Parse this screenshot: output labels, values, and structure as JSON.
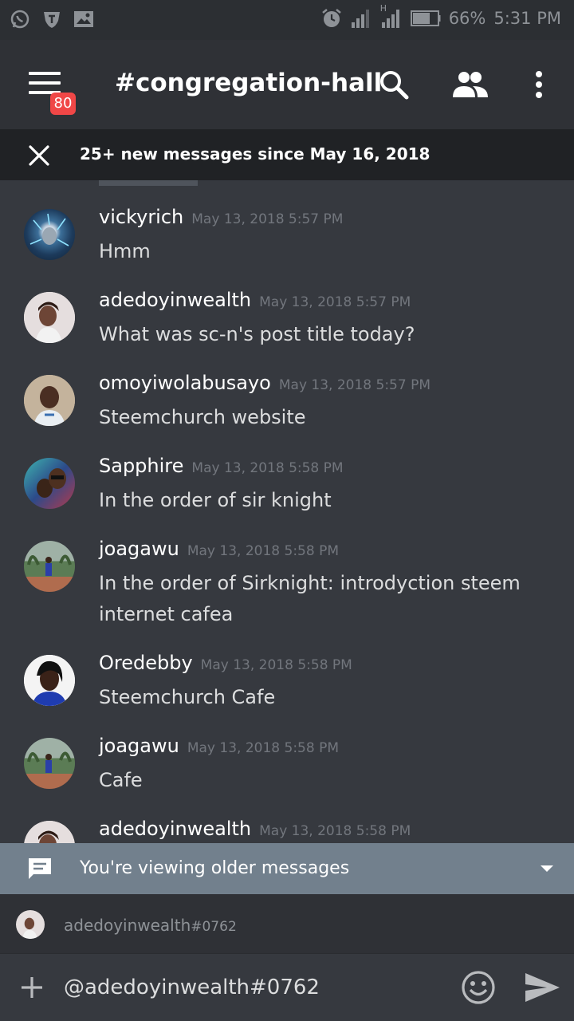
{
  "status_bar": {
    "battery": "66%",
    "time": "5:31 PM",
    "network": "H",
    "icons": [
      "whatsapp-icon",
      "shield-icon",
      "image-icon",
      "alarm-icon",
      "signal-icon",
      "battery-icon"
    ]
  },
  "header": {
    "channel": "#congregation-hall",
    "badge_count": "80",
    "icons": [
      "menu-icon",
      "search-icon",
      "members-icon",
      "more-icon"
    ]
  },
  "new_messages_bar": {
    "text": "25+ new messages since May 16, 2018"
  },
  "messages": [
    {
      "author": "vickyrich",
      "time": "May 13, 2018 5:57 PM",
      "text": "Hmm"
    },
    {
      "author": "adedoyinwealth",
      "time": "May 13, 2018 5:57 PM",
      "text": "What was sc-n's post title today?"
    },
    {
      "author": "omoyiwolabusayo",
      "time": "May 13, 2018 5:57 PM",
      "text": "Steemchurch website"
    },
    {
      "author": "Sapphire",
      "time": "May 13, 2018 5:58 PM",
      "text": "In the order of sir knight"
    },
    {
      "author": "joagawu",
      "time": "May 13, 2018 5:58 PM",
      "text": "In the order of Sirknight: introdyction steem internet cafea"
    },
    {
      "author": "Oredebby",
      "time": "May 13, 2018 5:58 PM",
      "text": "Steemchurch Cafe"
    },
    {
      "author": "joagawu",
      "time": "May 13, 2018 5:58 PM",
      "text": "Cafe"
    },
    {
      "author": "adedoyinwealth",
      "time": "May 13, 2018 5:58 PM",
      "text": ""
    }
  ],
  "older_bar": {
    "text": "You're viewing older messages"
  },
  "mention_suggestion": {
    "name": "adedoyinwealth",
    "discriminator": "#0762"
  },
  "composer": {
    "value": "@adedoyinwealth#0762"
  },
  "colors": {
    "background": "#36393f",
    "header": "#2f3136",
    "badge": "#f04747",
    "older_bar": "#72808d"
  }
}
